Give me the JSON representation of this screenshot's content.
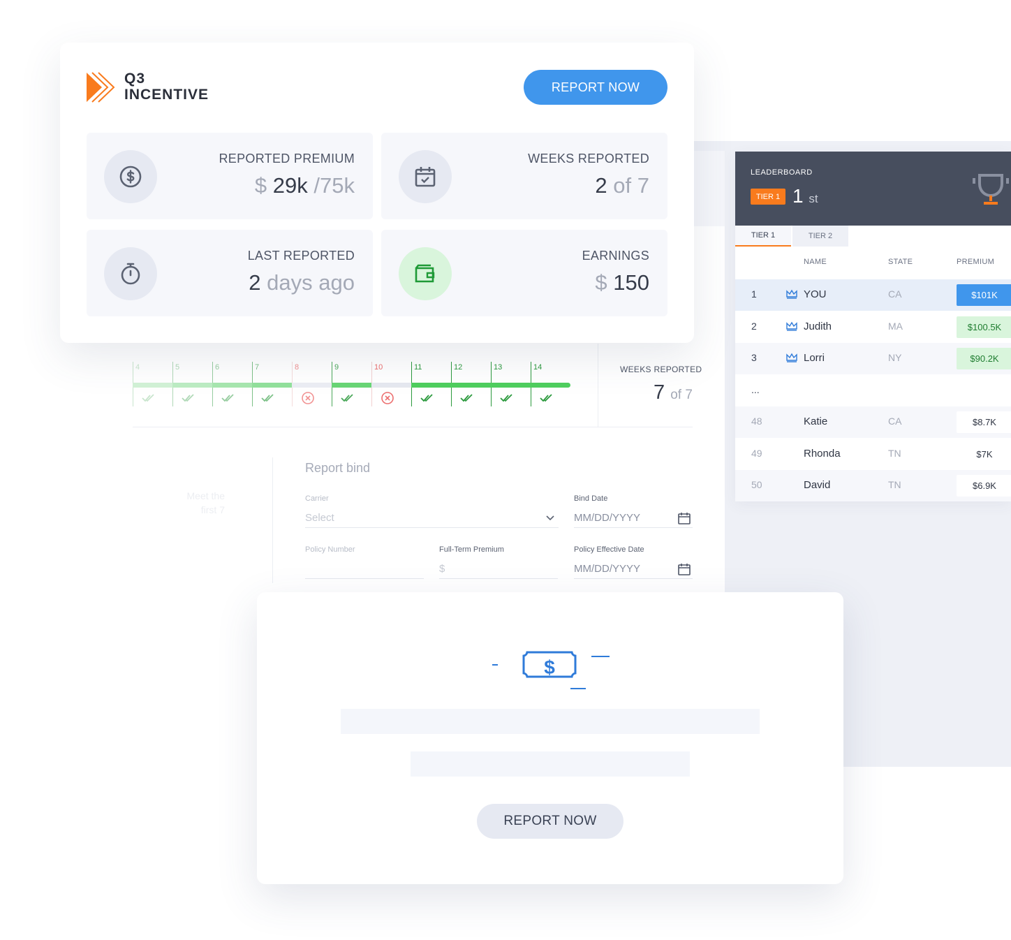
{
  "app": {
    "logo_line1": "Q3",
    "logo_line2": "INCENTIVE",
    "report_now": "REPORT NOW",
    "brand_color": "#f97b1d",
    "primary_color": "#4096ec"
  },
  "stats": [
    {
      "label": "REPORTED PREMIUM",
      "prefix": "$",
      "value": "29k",
      "suffix": "/75k",
      "icon": "dollar-circle-icon"
    },
    {
      "label": "WEEKS REPORTED",
      "prefix": "",
      "value": "2",
      "suffix": "of 7",
      "icon": "calendar-check-icon"
    },
    {
      "label": "LAST REPORTED",
      "prefix": "",
      "value": "2",
      "suffix": "days ago",
      "icon": "stopwatch-icon"
    },
    {
      "label": "EARNINGS",
      "prefix": "$",
      "value": "150",
      "suffix": "",
      "icon": "wallet-icon"
    }
  ],
  "timeline": {
    "weeks": [
      {
        "num": "4",
        "status": "done"
      },
      {
        "num": "5",
        "status": "done"
      },
      {
        "num": "6",
        "status": "done"
      },
      {
        "num": "7",
        "status": "done"
      },
      {
        "num": "8",
        "status": "missed"
      },
      {
        "num": "9",
        "status": "done"
      },
      {
        "num": "10",
        "status": "missed"
      },
      {
        "num": "11",
        "status": "done"
      },
      {
        "num": "12",
        "status": "done"
      },
      {
        "num": "13",
        "status": "done"
      },
      {
        "num": "14",
        "status": "done"
      }
    ],
    "weeks_reported_label": "WEEKS REPORTED",
    "weeks_reported_value": "7",
    "weeks_reported_suffix": "of 7"
  },
  "faded_note": {
    "line1": "Meet the",
    "line2": "first 7"
  },
  "report_bind": {
    "title": "Report bind",
    "carrier_label": "Carrier",
    "carrier_placeholder": "Select",
    "bind_date_label": "Bind Date",
    "bind_date_placeholder": "MM/DD/YYYY",
    "policy_number_label": "Policy Number",
    "full_term_label": "Full-Term Premium",
    "full_term_placeholder": "$",
    "effective_date_label": "Policy Effective Date",
    "effective_date_placeholder": "MM/DD/YYYY"
  },
  "leaderboard": {
    "title": "LEADERBOARD",
    "tier_badge": "TIER 1",
    "rank": "1",
    "rank_suffix": "st",
    "tabs": [
      "TIER 1",
      "TIER 2"
    ],
    "columns": [
      "NAME",
      "STATE",
      "PREMIUM"
    ],
    "rows": [
      {
        "rank": "1",
        "name": "YOU",
        "state": "CA",
        "premium": "$101K",
        "crown": true,
        "style": "you"
      },
      {
        "rank": "2",
        "name": "Judith",
        "state": "MA",
        "premium": "$100.5K",
        "crown": true,
        "style": "top"
      },
      {
        "rank": "3",
        "name": "Lorri",
        "state": "NY",
        "premium": "$90.2K",
        "crown": true,
        "style": "top"
      },
      {
        "rank": "...",
        "name": "",
        "state": "",
        "premium": "",
        "crown": false,
        "style": "gap"
      },
      {
        "rank": "48",
        "name": "Katie",
        "state": "CA",
        "premium": "$8.7K",
        "crown": false,
        "style": "low"
      },
      {
        "rank": "49",
        "name": "Rhonda",
        "state": "TN",
        "premium": "$7K",
        "crown": false,
        "style": "low"
      },
      {
        "rank": "50",
        "name": "David",
        "state": "TN",
        "premium": "$6.9K",
        "crown": false,
        "style": "low"
      }
    ]
  },
  "bottom_card": {
    "icon": "money-bill-icon",
    "report_now": "REPORT NOW"
  }
}
